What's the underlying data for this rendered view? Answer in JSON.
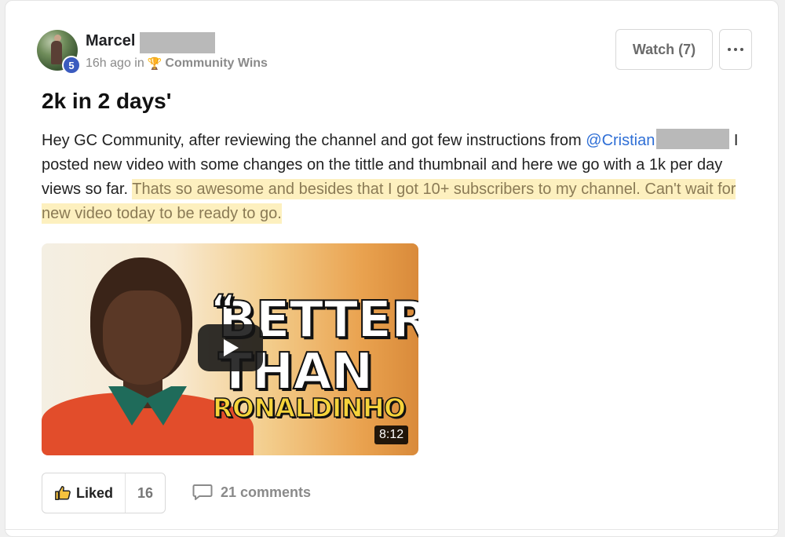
{
  "post": {
    "author_first": "Marcel",
    "level": "5",
    "time": "16h ago in",
    "category": "Community Wins",
    "title": "2k in 2 days'",
    "body_part1": "Hey GC Community, after reviewing the channel and got few instructions from ",
    "mention": "@Cristian",
    "body_part2": " I posted new video with some changes on the tittle and thumbnail and here we go with a 1k per day views so far. ",
    "body_highlight": "Thats so awesome and besides that I got 10+ subscribers to my channel. Can't wait for new video today to be ready to go."
  },
  "actions": {
    "watch_label": "Watch (7)",
    "liked_label": "Liked",
    "like_count": "16",
    "comments_label": "21 comments"
  },
  "video": {
    "thumb_line1": "BETTER",
    "thumb_line2": "THAN",
    "thumb_line3": "RONALDINHO",
    "duration": "8:12"
  },
  "icons": {
    "trophy": "trophy-icon",
    "more": "more-horizontal-icon",
    "play": "play-icon",
    "thumbs_up": "thumbs-up-icon",
    "comment": "comment-icon"
  }
}
